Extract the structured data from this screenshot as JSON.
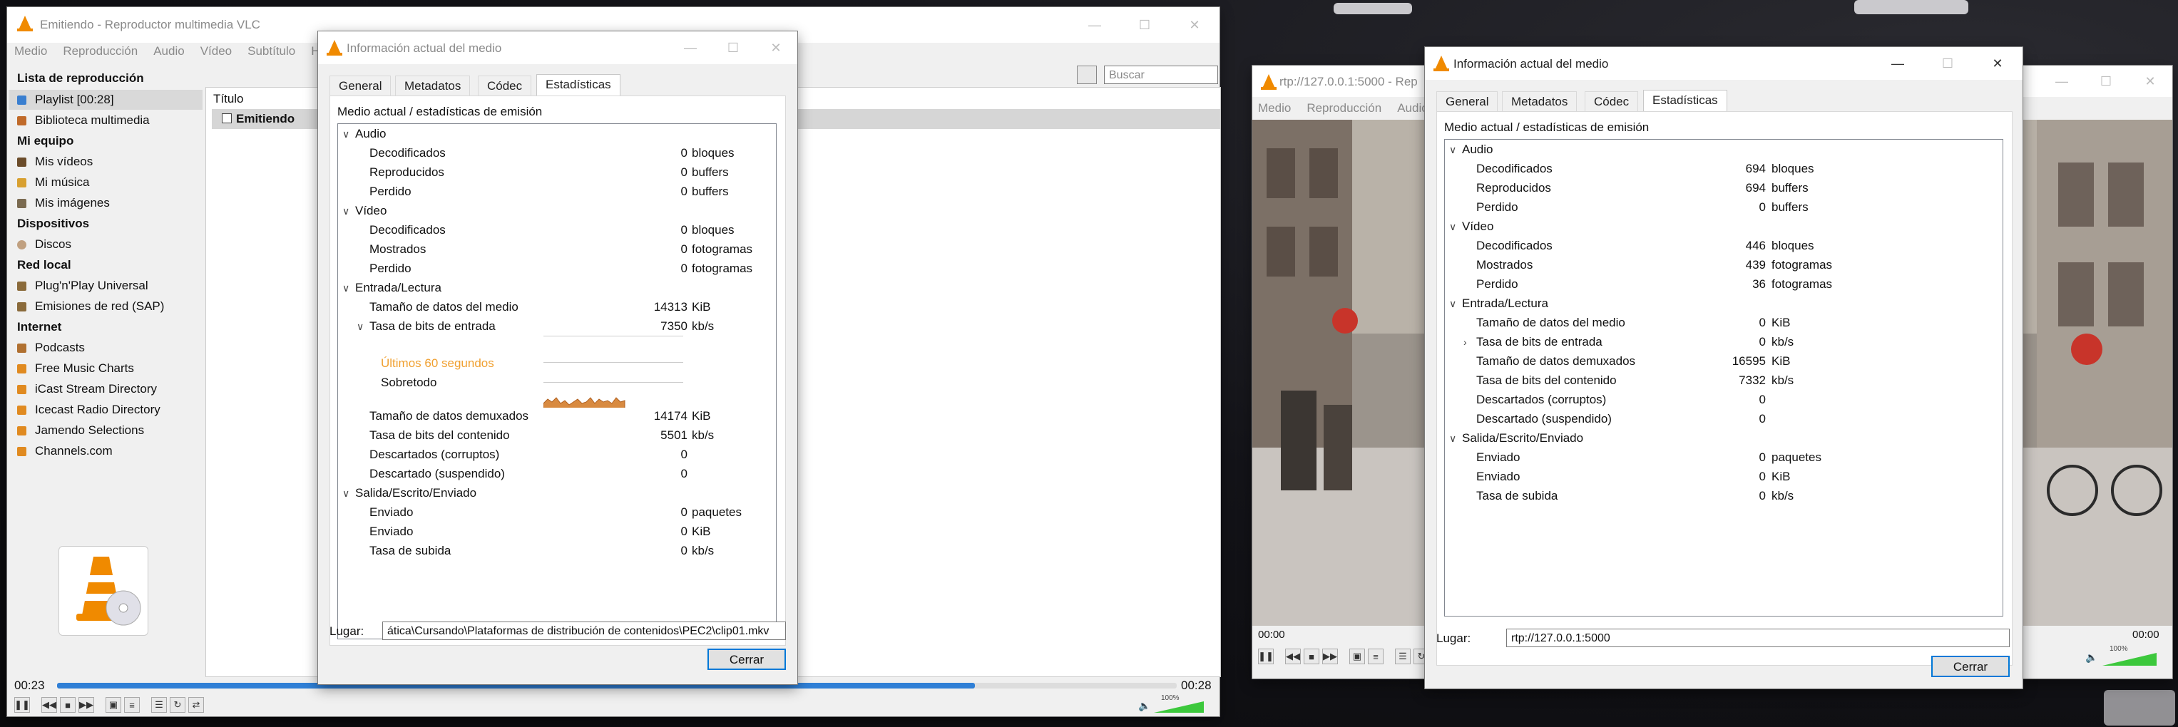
{
  "vlc_main": {
    "title": "Emitiendo - Reproductor multimedia VLC",
    "menu": [
      "Medio",
      "Reproducción",
      "Audio",
      "Vídeo",
      "Subtítulo",
      "H"
    ],
    "search_placeholder": "Buscar",
    "sidebar": {
      "playlist_header": "Lista de reproducción",
      "playlist_item": "Playlist [00:28]",
      "library_item": "Biblioteca multimedia",
      "my_pc_header": "Mi equipo",
      "my_videos": "Mis vídeos",
      "my_music": "Mi música",
      "my_images": "Mis imágenes",
      "devices_header": "Dispositivos",
      "discs": "Discos",
      "lan_header": "Red local",
      "upnp": "Plug'n'Play Universal",
      "sap": "Emisiones de red (SAP)",
      "internet_header": "Internet",
      "podcasts": "Podcasts",
      "free_music": "Free Music Charts",
      "icast": "iCast Stream Directory",
      "icecast": "Icecast Radio Directory",
      "jamendo": "Jamendo Selections",
      "channels": "Channels.com"
    },
    "playlist": {
      "column_title": "Título",
      "row_label": "Emitiendo"
    },
    "time_elapsed": "00:23",
    "time_total": "00:28",
    "seek_progress": 0.82,
    "volume_label": "100%"
  },
  "info_left": {
    "title": "Información actual del medio",
    "tabs": [
      "General",
      "Metadatos",
      "Códec",
      "Estadísticas"
    ],
    "section_heading": "Medio actual / estadísticas de emisión",
    "groups": {
      "audio": "Audio",
      "video": "Vídeo",
      "input": "Entrada/Lectura",
      "output": "Salida/Escrito/Enviado"
    },
    "labels": {
      "decoded": "Decodificados",
      "played": "Reproducidos",
      "lost": "Perdido",
      "displayed": "Mostrados",
      "media_size": "Tamaño de datos del medio",
      "input_bitrate": "Tasa de bits de entrada",
      "last60": "Últimos 60 segundos",
      "overall": "Sobretodo",
      "demux_size": "Tamaño de datos demuxados",
      "content_bitrate": "Tasa de bits del contenido",
      "discarded_corrupt": "Descartados (corruptos)",
      "discarded_suspended": "Descartado (suspendido)",
      "sent": "Enviado",
      "upload_rate": "Tasa de subida"
    },
    "values": {
      "audio_decoded": "0",
      "audio_decoded_unit": "bloques",
      "audio_played": "0",
      "audio_played_unit": "buffers",
      "audio_lost": "0",
      "audio_lost_unit": "buffers",
      "video_decoded": "0",
      "video_decoded_unit": "bloques",
      "video_displayed": "0",
      "video_displayed_unit": "fotogramas",
      "video_lost": "0",
      "video_lost_unit": "fotogramas",
      "media_size": "14313",
      "media_size_unit": "KiB",
      "input_bitrate": "7350",
      "input_bitrate_unit": "kb/s",
      "demux_size": "14174",
      "demux_size_unit": "KiB",
      "content_bitrate": "5501",
      "content_bitrate_unit": "kb/s",
      "discarded_corrupt": "0",
      "discarded_suspended": "0",
      "sent_packets": "0",
      "sent_packets_unit": "paquetes",
      "sent_kib": "0",
      "sent_kib_unit": "KiB",
      "upload_rate": "0",
      "upload_rate_unit": "kb/s"
    },
    "location_label": "Lugar:",
    "location_value": "ática\\Cursando\\Plataformas de distribución de contenidos\\PEC2\\clip01.mkv",
    "close_label": "Cerrar"
  },
  "vlc_second": {
    "title": "rtp://127.0.0.1:5000 - Rep",
    "menu": [
      "Medio",
      "Reproducción",
      "Audio"
    ],
    "time_elapsed": "00:00",
    "time_total": "00:00",
    "volume_label": "100%"
  },
  "info_right": {
    "title": "Información actual del medio",
    "tabs": [
      "General",
      "Metadatos",
      "Códec",
      "Estadísticas"
    ],
    "section_heading": "Medio actual / estadísticas de emisión",
    "groups": {
      "audio": "Audio",
      "video": "Vídeo",
      "input": "Entrada/Lectura",
      "output": "Salida/Escrito/Enviado"
    },
    "labels": {
      "decoded": "Decodificados",
      "played": "Reproducidos",
      "lost": "Perdido",
      "displayed": "Mostrados",
      "media_size": "Tamaño de datos del medio",
      "input_bitrate": "Tasa de bits de entrada",
      "demux_size": "Tamaño de datos demuxados",
      "content_bitrate": "Tasa de bits del contenido",
      "discarded_corrupt": "Descartados (corruptos)",
      "discarded_suspended": "Descartado (suspendido)",
      "sent": "Enviado",
      "upload_rate": "Tasa de subida"
    },
    "values": {
      "audio_decoded": "694",
      "audio_decoded_unit": "bloques",
      "audio_played": "694",
      "audio_played_unit": "buffers",
      "audio_lost": "0",
      "audio_lost_unit": "buffers",
      "video_decoded": "446",
      "video_decoded_unit": "bloques",
      "video_displayed": "439",
      "video_displayed_unit": "fotogramas",
      "video_lost": "36",
      "video_lost_unit": "fotogramas",
      "media_size": "0",
      "media_size_unit": "KiB",
      "input_bitrate": "0",
      "input_bitrate_unit": "kb/s",
      "demux_size": "16595",
      "demux_size_unit": "KiB",
      "content_bitrate": "7332",
      "content_bitrate_unit": "kb/s",
      "discarded_corrupt": "0",
      "discarded_suspended": "0",
      "sent_packets": "0",
      "sent_packets_unit": "paquetes",
      "sent_kib": "0",
      "sent_kib_unit": "KiB",
      "upload_rate": "0",
      "upload_rate_unit": "kb/s"
    },
    "location_label": "Lugar:",
    "location_value": "rtp://127.0.0.1:5000",
    "close_label": "Cerrar"
  },
  "colors": {
    "accent_blue": "#0078d7",
    "vlc_orange": "#f08a00",
    "graph_label_orange": "#f0a030",
    "volume_green": "#3cc83c"
  }
}
